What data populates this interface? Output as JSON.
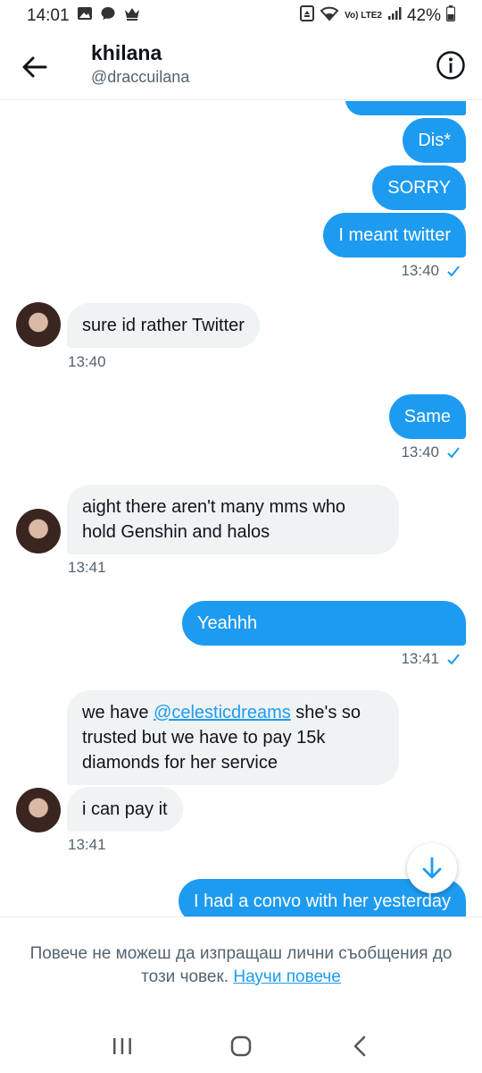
{
  "status_bar": {
    "time": "14:01",
    "network": "Vo) LTE2",
    "battery": "42%"
  },
  "header": {
    "name": "khilana",
    "handle": "@draccuilana"
  },
  "messages": [
    {
      "dir": "out",
      "text": "Dis*"
    },
    {
      "dir": "out",
      "text": "SORRY"
    },
    {
      "dir": "out",
      "text": "I meant twitter"
    },
    {
      "dir": "out_ts",
      "text": "13:40"
    },
    {
      "dir": "in",
      "text": "sure id rather Twitter"
    },
    {
      "dir": "in_ts",
      "text": "13:40"
    },
    {
      "dir": "out",
      "text": "Same"
    },
    {
      "dir": "out_ts",
      "text": "13:40"
    },
    {
      "dir": "in",
      "text": "aight there aren't many mms who hold Genshin and halos"
    },
    {
      "dir": "in_ts",
      "text": "13:41"
    },
    {
      "dir": "out",
      "text": "Yeahhh"
    },
    {
      "dir": "out_ts",
      "text": "13:41"
    },
    {
      "dir": "in",
      "text_before": "we have ",
      "mention": "@celesticdreams",
      "text_after": " she's so trusted but we have to pay 15k diamonds for her service"
    },
    {
      "dir": "in",
      "text": "i can pay it"
    },
    {
      "dir": "in_ts",
      "text": "13:41"
    },
    {
      "dir": "out",
      "text": "I had a convo with her yesterday"
    }
  ],
  "notice": {
    "text": "Повече не можеш да изпращаш лични съобщения до този човек.",
    "link": "Научи повече"
  },
  "colors": {
    "accent": "#1d9bf0",
    "incoming_bubble": "#eff3f4",
    "secondary_text": "#536471"
  }
}
